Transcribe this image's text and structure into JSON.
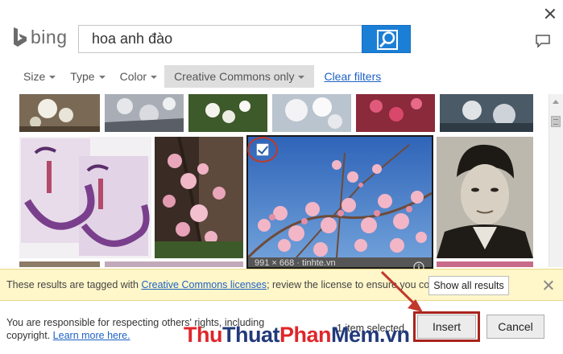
{
  "header": {
    "logo_text": "bing",
    "search_value": "hoa anh đào"
  },
  "filters": {
    "items": [
      {
        "label": "Size"
      },
      {
        "label": "Type"
      },
      {
        "label": "Color"
      },
      {
        "label": "Creative Commons only"
      }
    ],
    "clear_label": "Clear filters"
  },
  "results": {
    "selected_caption": "991 × 668 · tinhte.vn"
  },
  "notice": {
    "text_before": "These results are tagged with ",
    "link": "Creative Commons licenses",
    "text_after": "; review the license to ensure you comply.",
    "show_all_label": "Show all results"
  },
  "footer": {
    "responsibility_text": "You are responsible for respecting others' rights, including copyright. ",
    "learn_more": "Learn more here.",
    "selected_count": "1 item selected.",
    "insert_label": "Insert",
    "cancel_label": "Cancel"
  },
  "watermark": {
    "part1": "Thu",
    "part2": "Thuat",
    "part3": "Phan",
    "part4": "Mem",
    "part5": ".vn"
  },
  "colors": {
    "accent_blue": "#1c7fd6",
    "link_blue": "#1d62c4",
    "notice_bg": "#fff6c9",
    "highlight_red": "#c0392b"
  },
  "icons": [
    "close-icon",
    "bing-logo-icon",
    "search-icon",
    "feedback-icon",
    "caret-down-icon",
    "checkbox-icon",
    "info-icon",
    "notice-close-icon"
  ]
}
